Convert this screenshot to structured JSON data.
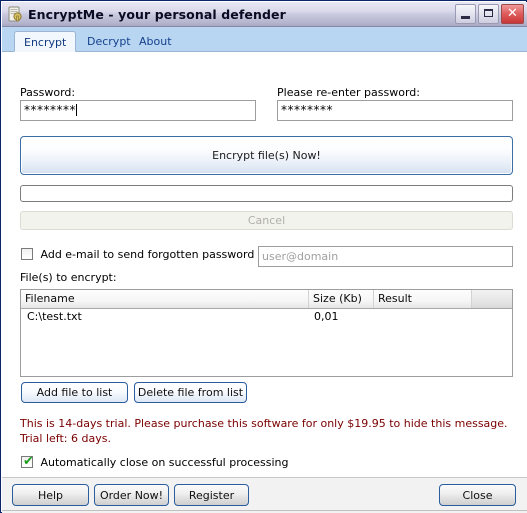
{
  "window": {
    "title": "EncryptMe - your personal defender",
    "icon": "document-lock-icon",
    "minimize_label": "_",
    "maximize_label": "□",
    "close_label": "✕"
  },
  "tabs": [
    {
      "label": "Encrypt",
      "active": true
    },
    {
      "label": "Decrypt",
      "active": false
    },
    {
      "label": "About",
      "active": false
    }
  ],
  "form": {
    "password_label": "Password:",
    "password_value": "********",
    "reenter_label": "Please re-enter password:",
    "reenter_value": "********",
    "encrypt_button": "Encrypt file(s) Now!",
    "cancel_button": "Cancel",
    "progress_value": 0,
    "email_checkbox_label": "Add e-mail to send forgotten password",
    "email_checkbox_checked": false,
    "email_placeholder": "user@domain",
    "email_value": "",
    "files_label": "File(s) to encrypt:"
  },
  "filelist": {
    "columns": [
      "Filename",
      "Size (Kb)",
      "Result",
      ""
    ],
    "rows": [
      {
        "filename": "C:\\test.txt",
        "size": "0,01",
        "result": ""
      }
    ]
  },
  "list_buttons": {
    "add": "Add file to list",
    "delete": "Delete file from list"
  },
  "trial": {
    "message": "This is 14-days trial. Please purchase this software for only $19.95 to hide this message. Trial left: 6 days.",
    "color": "#7a0000"
  },
  "autoclose": {
    "label": "Automatically close on successful processing",
    "checked": true,
    "tick": "✔"
  },
  "footer": {
    "help": "Help",
    "order": "Order Now!",
    "register": "Register",
    "close": "Close"
  },
  "colors": {
    "tabstrip": "#b8d5f2",
    "accent": "#2a5d9e",
    "trial_text": "#7a0000",
    "check_green": "#1f9c1f"
  }
}
